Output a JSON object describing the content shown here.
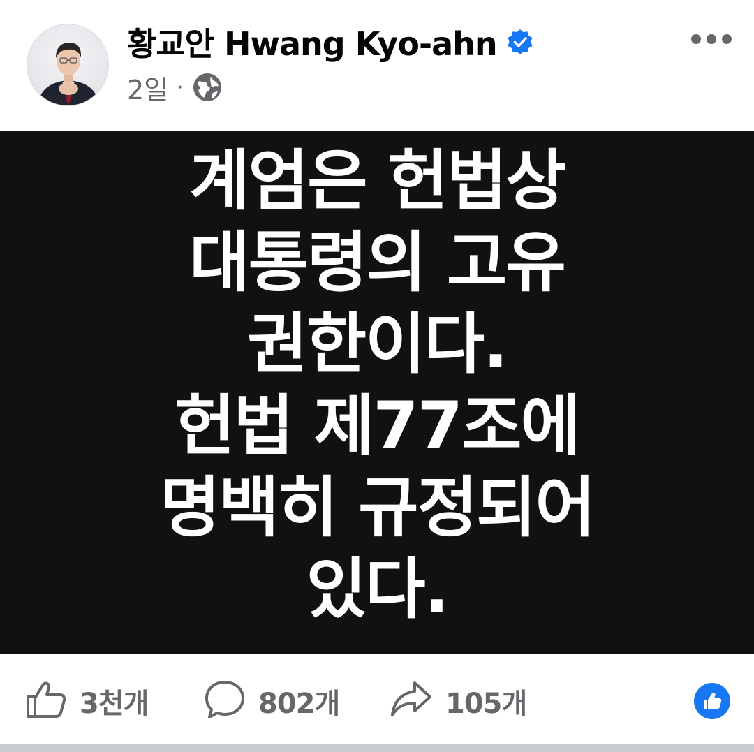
{
  "post": {
    "author": "황교안 Hwang Kyo-ahn",
    "time": "2일",
    "separator": "·",
    "image_text_lines": [
      "계엄은 헌법상",
      "대통령의 고유",
      "권한이다.",
      "헌법 제77조에",
      "명백히 규정되어",
      "있다."
    ]
  },
  "actions": {
    "likes": "3천개",
    "comments": "802개",
    "shares": "105개"
  },
  "icons": {
    "verified": "verified-badge-icon",
    "audience": "globe-icon",
    "more": "more-options-icon",
    "like": "thumbs-up-icon",
    "comment": "comment-bubble-icon",
    "share": "share-arrow-icon",
    "reaction": "like-reaction-icon"
  },
  "colors": {
    "brand_blue": "#1877f2",
    "secondary_text": "#65676b",
    "image_background": "#111111",
    "image_text": "#ffffff"
  }
}
